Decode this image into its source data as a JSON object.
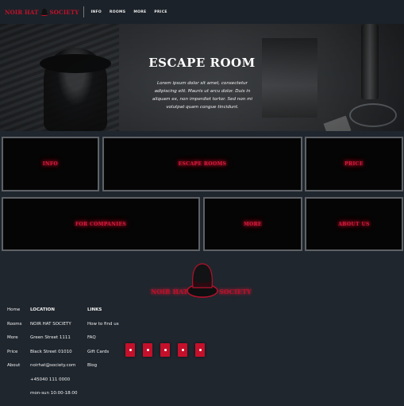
{
  "nav": {
    "brand_left": "NOIR HAT",
    "brand_right": "SOCIETY",
    "links": [
      "INFO",
      "ROOMS",
      "MORE",
      "PRICE"
    ]
  },
  "hero": {
    "title": "ESCAPE ROOM",
    "text": "Lorem ipsum dolor sit amet, consectetur adipiscing elit. Mauris ut arcu dolor. Duis in aliquam ex, non imperdiet tortor. Sed non mi volutpat quam congue tincidunt."
  },
  "tiles": {
    "info": "INFO",
    "escape_rooms": "ESCAPE ROOMS",
    "price": "PRICE",
    "for_companies": "FOR COMPANIES",
    "more": "MORE",
    "about_us": "ABOUT US"
  },
  "footer": {
    "logo_left": "NOIR HAT",
    "logo_right": "SOCIETY",
    "nav": [
      "Home",
      "Rooms",
      "More",
      "Price",
      "About"
    ],
    "location": {
      "heading": "LOCATION",
      "lines": [
        "NOIR HAT SOCIETY",
        "Green Street 1111",
        "Black Street 01010",
        "noirhat@society.com",
        "+45040 111 0000",
        "mon-sun 10:00-18:00"
      ]
    },
    "links": {
      "heading": "LINKS",
      "items": [
        "How to find us",
        "FAQ",
        "Gift Cards",
        "Blog"
      ]
    },
    "social_icons": [
      "instagram-icon",
      "pinterest-icon",
      "twitter-icon",
      "youtube-icon",
      "facebook-icon"
    ]
  },
  "colors": {
    "accent": "#c4102a",
    "background": "#1f262e",
    "tile_bg": "#050505"
  }
}
